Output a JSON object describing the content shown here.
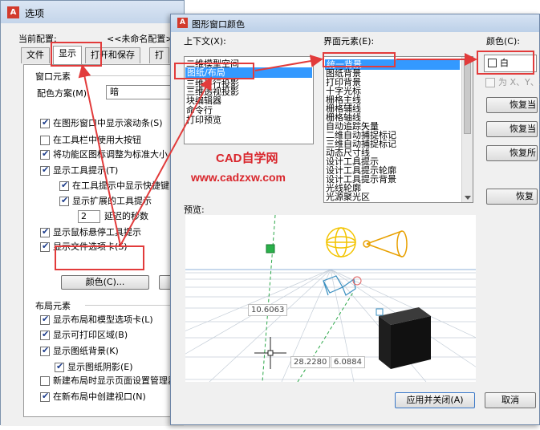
{
  "options_dialog": {
    "title": "选项",
    "current_profile_label": "当前配置:",
    "current_profile_value": "<<未命名配置>>",
    "tabs": [
      "文件",
      "显示",
      "打开和保存",
      "打"
    ],
    "active_tab": "显示",
    "window_elements": {
      "heading": "窗口元素",
      "color_scheme_label": "配色方案(M):",
      "color_scheme_value": "暗",
      "checkboxes": [
        {
          "label": "在图形窗口中显示滚动条(S)",
          "checked": true
        },
        {
          "label": "在工具栏中使用大按钮",
          "checked": false
        },
        {
          "label": "将功能区图标调整为标准大小",
          "checked": true
        },
        {
          "label": "显示工具提示(T)",
          "checked": true
        },
        {
          "label": "在工具提示中显示快捷键",
          "checked": true
        },
        {
          "label": "显示扩展的工具提示",
          "checked": true
        }
      ],
      "delay_value": "2",
      "delay_label": "延迟的秒数",
      "checkboxes_2": [
        {
          "label": "显示鼠标悬停工具提示",
          "checked": true
        },
        {
          "label": "显示文件选项卡(S)",
          "checked": true
        }
      ],
      "colors_button": "颜色(C)...",
      "fonts_button_partial": "字"
    },
    "layout_elements": {
      "heading": "布局元素",
      "checkboxes": [
        {
          "label": "显示布局和模型选项卡(L)",
          "checked": true
        },
        {
          "label": "显示可打印区域(B)",
          "checked": true
        },
        {
          "label": "显示图纸背景(K)",
          "checked": true
        },
        {
          "label": "显示图纸阴影(E)",
          "checked": true
        },
        {
          "label": "新建布局时显示页面设置管理器",
          "checked": false
        },
        {
          "label": "在新布局中创建视口(N)",
          "checked": true
        }
      ]
    }
  },
  "drawing_window_colors": {
    "title": "图形窗口颜色",
    "context_label": "上下文(X):",
    "context_items": [
      "二维模型空间",
      "图纸/布局",
      "三维平行投影",
      "三维透视投影",
      "块编辑器",
      "命令行",
      "打印预览"
    ],
    "context_selected": "图纸/布局",
    "interface_label": "界面元素(E):",
    "interface_items": [
      "统一背景",
      "图纸背景",
      "打印背景",
      "十字光标",
      "栅格主线",
      "栅格辅线",
      "栅格轴线",
      "自动追踪矢量",
      "二维自动捕捉标记",
      "三维自动捕捉标记",
      "动态尺寸线",
      "设计工具提示",
      "设计工具提示轮廓",
      "设计工具提示背景",
      "光线轮廓",
      "光源聚光区"
    ],
    "interface_selected": "统一背景",
    "color_label": "颜色(C):",
    "color_value": "白",
    "tint_label": "为 X、Y、Z",
    "restore_buttons": [
      "恢复当",
      "恢复当",
      "恢复所",
      "恢复"
    ],
    "watermark_title": "CAD自学网",
    "watermark_url": "www.cadzxw.com",
    "preview_label": "预览:",
    "preview_readouts": [
      "10.6063",
      "28.2280",
      "6.0884"
    ],
    "apply_button": "应用并关闭(A)",
    "cancel_button": "取消"
  },
  "colors": {
    "accent_selection": "#3399ff",
    "annotation_red": "#e23b3b",
    "watermark_red": "#d9262c"
  }
}
